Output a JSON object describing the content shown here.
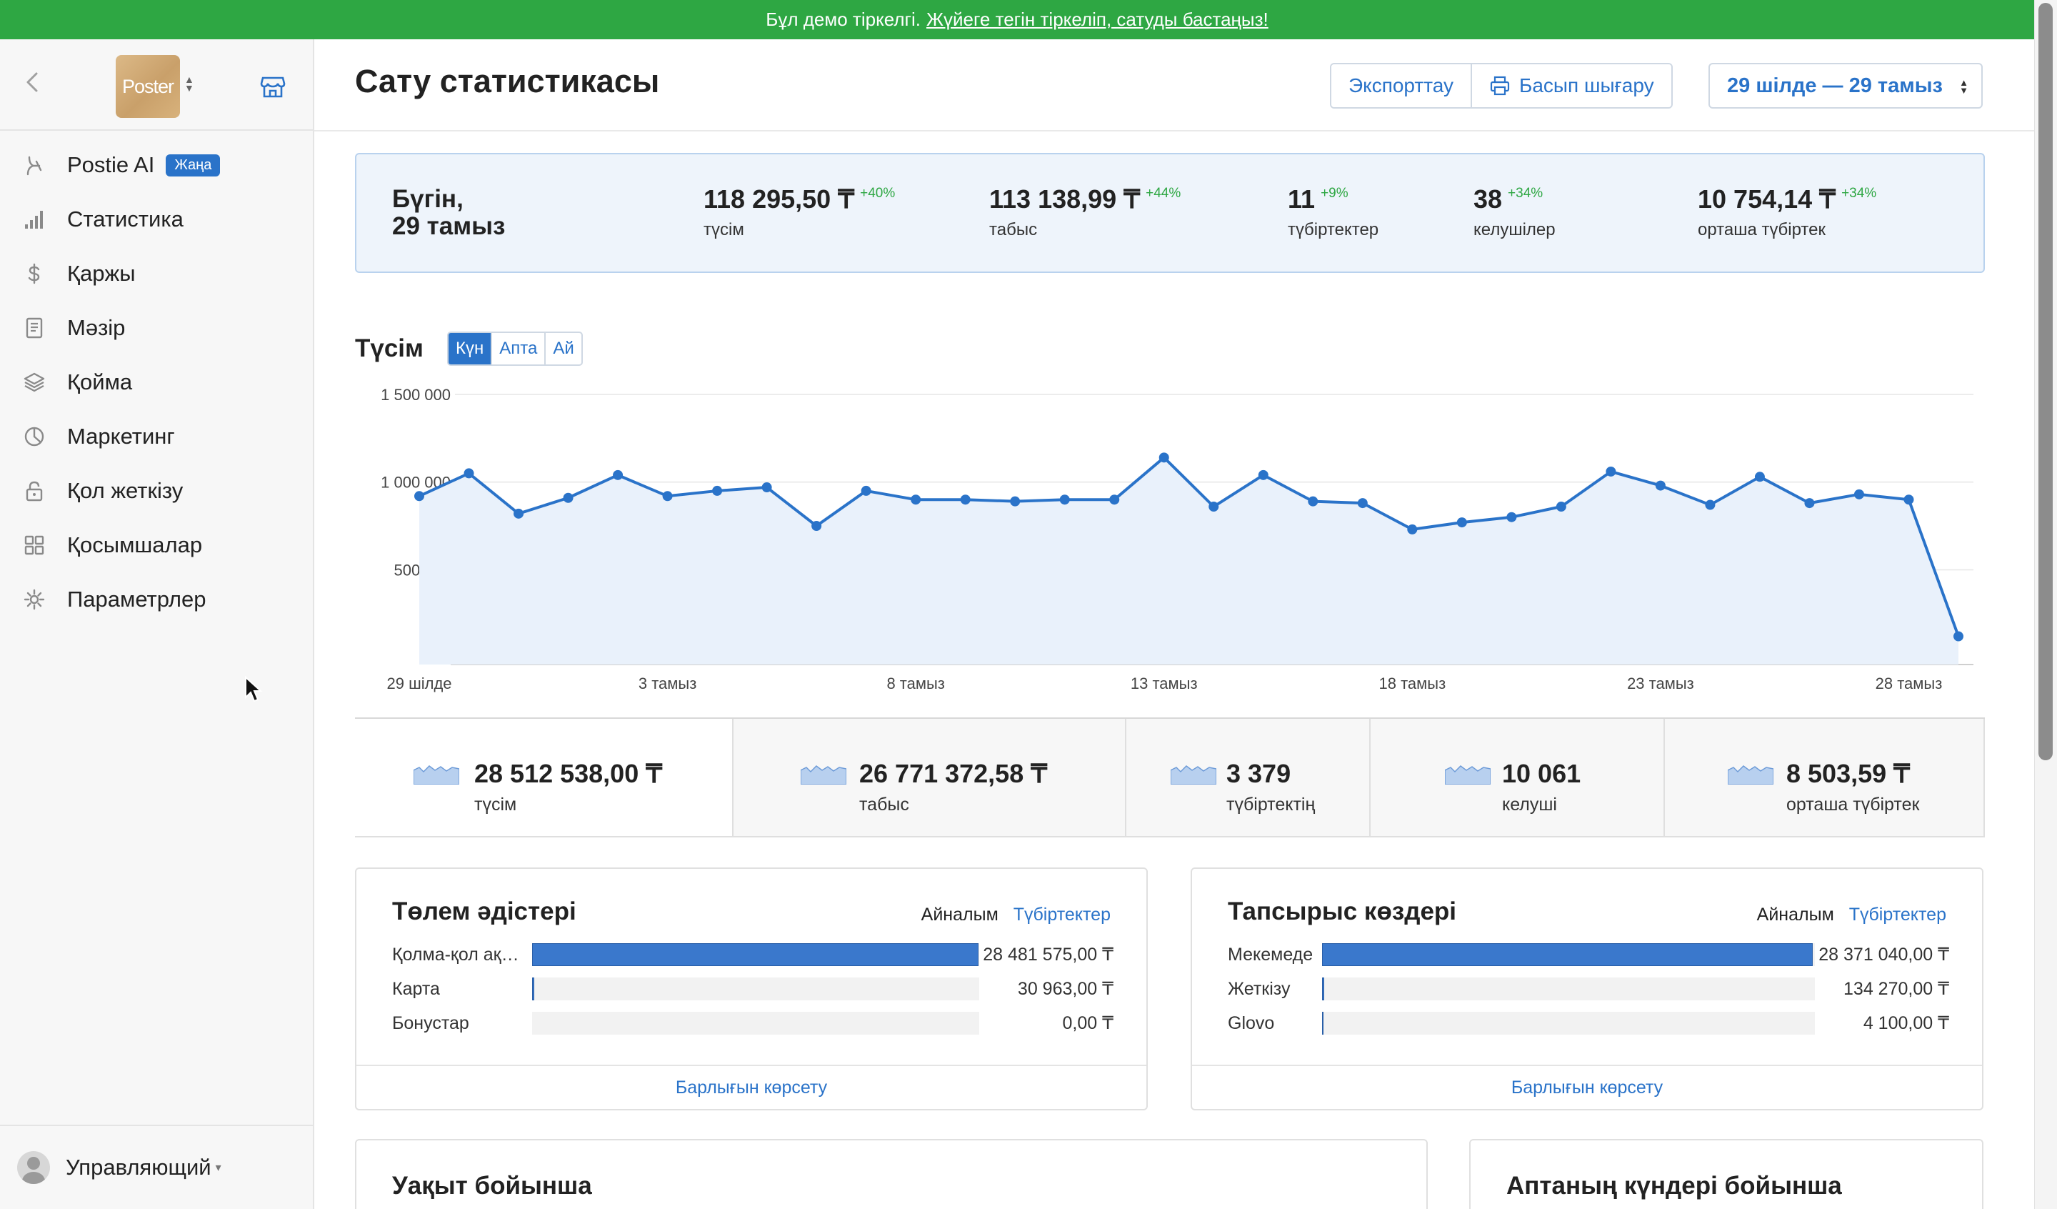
{
  "banner": {
    "text": "Бұл демо тіркелгі.",
    "link": "Жүйеге тегін тіркеліп, сатуды бастаңыз!"
  },
  "sidebar": {
    "logo_text": "Poster",
    "items": [
      {
        "label": "Postie AI",
        "icon": "ai-sparkle-icon",
        "badge": "Жаңа"
      },
      {
        "label": "Статистика",
        "icon": "bar-chart-icon"
      },
      {
        "label": "Қаржы",
        "icon": "dollar-icon"
      },
      {
        "label": "Мәзір",
        "icon": "document-icon"
      },
      {
        "label": "Қойма",
        "icon": "layers-icon"
      },
      {
        "label": "Маркетинг",
        "icon": "pie-icon"
      },
      {
        "label": "Қол жеткізу",
        "icon": "lock-icon"
      },
      {
        "label": "Қосымшалар",
        "icon": "grid-icon"
      },
      {
        "label": "Параметрлер",
        "icon": "gear-icon"
      }
    ],
    "user": "Управляющий"
  },
  "header": {
    "title": "Сату статистикасы",
    "export_label": "Экспорттау",
    "print_label": "Басып шығару",
    "date_range": "29 шілде — 29 тамыз"
  },
  "today": {
    "label_line1": "Бүгін,",
    "label_line2": "29 тамыз",
    "kpis": [
      {
        "value": "118 295,50 ₸",
        "pct": "+40%",
        "label": "түсім"
      },
      {
        "value": "113 138,99 ₸",
        "pct": "+44%",
        "label": "табыс"
      },
      {
        "value": "11",
        "pct": "+9%",
        "label": "түбіртектер"
      },
      {
        "value": "38",
        "pct": "+34%",
        "label": "келушілер"
      },
      {
        "value": "10 754,14 ₸",
        "pct": "+34%",
        "label": "орташа түбіртек"
      }
    ]
  },
  "revenue": {
    "title": "Түсім",
    "periods": [
      "Күн",
      "Апта",
      "Ай"
    ],
    "active_period": "Күн"
  },
  "chart_data": {
    "type": "area",
    "title": "Түсім",
    "x": [
      "29 шілде",
      "30 шілде",
      "31 шілде",
      "1 тамыз",
      "2 тамыз",
      "3 тамыз",
      "4 тамыз",
      "5 тамыз",
      "6 тамыз",
      "7 тамыз",
      "8 тамыз",
      "9 тамыз",
      "10 тамыз",
      "11 тамыз",
      "12 тамыз",
      "13 тамыз",
      "14 тамыз",
      "15 тамыз",
      "16 тамыз",
      "17 тамыз",
      "18 тамыз",
      "19 тамыз",
      "20 тамыз",
      "21 тамыз",
      "22 тамыз",
      "23 тамыз",
      "24 тамыз",
      "25 тамыз",
      "26 тамыз",
      "27 тамыз",
      "28 тамыз",
      "29 тамыз"
    ],
    "x_tick_labels": [
      "29 шілде",
      "3 тамыз",
      "8 тамыз",
      "13 тамыз",
      "18 тамыз",
      "23 тамыз",
      "28 тамыз"
    ],
    "x_tick_indices": [
      0,
      5,
      10,
      15,
      20,
      25,
      30
    ],
    "series": [
      {
        "values": [
          920000,
          1050000,
          820000,
          910000,
          1040000,
          920000,
          950000,
          970000,
          750000,
          950000,
          900000,
          900000,
          890000,
          900000,
          900000,
          1140000,
          860000,
          1040000,
          890000,
          880000,
          730000,
          770000,
          800000,
          860000,
          1060000,
          980000,
          870000,
          1030000,
          880000,
          930000,
          900000,
          120000
        ]
      }
    ],
    "y_tick_labels": [
      "500 000",
      "1 000 000",
      "1 500 000"
    ],
    "y_ticks": [
      500000,
      1000000,
      1500000
    ],
    "ylim": [
      0,
      1500000
    ],
    "grid": true,
    "color": "#2a73c9"
  },
  "totals": [
    {
      "value": "28 512 538,00 ₸",
      "label": "түсім"
    },
    {
      "value": "26 771 372,58 ₸",
      "label": "табыс"
    },
    {
      "value": "3 379",
      "label": "түбіртектің"
    },
    {
      "value": "10 061",
      "label": "келуші"
    },
    {
      "value": "8 503,59 ₸",
      "label": "орташа түбіртек"
    }
  ],
  "payment": {
    "title": "Төлем әдістері",
    "tab1": "Айналым",
    "tab2": "Түбіртектер",
    "rows": [
      {
        "label": "Қолма-қол ақ…",
        "value": "28 481 575,00 ₸",
        "share": 0.999
      },
      {
        "label": "Карта",
        "value": "30 963,00 ₸",
        "share": 0.004
      },
      {
        "label": "Бонустар",
        "value": "0,00 ₸",
        "share": 0
      }
    ],
    "show_all": "Барлығын көрсету"
  },
  "sources": {
    "title": "Тапсырыс көздері",
    "tab1": "Айналым",
    "tab2": "Түбіртектер",
    "rows": [
      {
        "label": "Мекемеде",
        "value": "28 371 040,00 ₸",
        "share": 0.995
      },
      {
        "label": "Жеткізу",
        "value": "134 270,00 ₸",
        "share": 0.005
      },
      {
        "label": "Glovo",
        "value": "4 100,00 ₸",
        "share": 0.003
      }
    ],
    "show_all": "Барлығын көрсету"
  },
  "bottom": {
    "by_time": "Уақыт бойынша",
    "by_weekday": "Аптаның күндері бойынша"
  }
}
